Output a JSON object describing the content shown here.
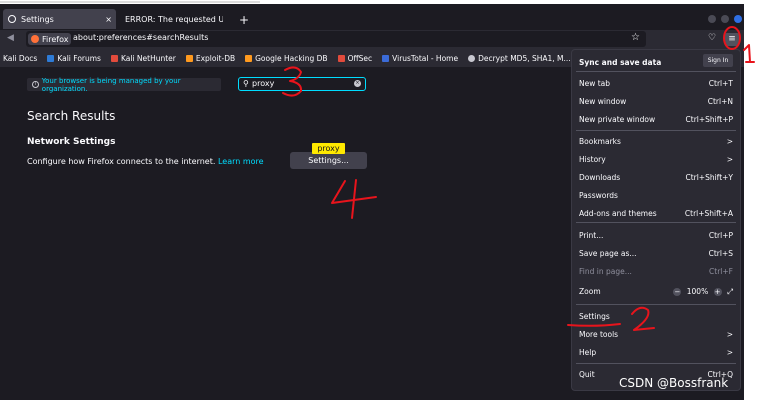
{
  "tabs": [
    {
      "label": "Settings",
      "close": "×"
    },
    {
      "label": "ERROR: The requested URL c"
    }
  ],
  "newtab_label": "+",
  "nav": {
    "identity_label": "Firefox",
    "url": "about:preferences#searchResults",
    "star_icon": "star-icon",
    "menu_icon": "≡"
  },
  "bookmarks": [
    {
      "label": "Kali Docs",
      "color": "#2e7bd6"
    },
    {
      "label": "Kali Forums",
      "color": "#2e7bd6"
    },
    {
      "label": "Kali NetHunter",
      "color": "#e24b3c"
    },
    {
      "label": "Exploit-DB",
      "color": "#ff9a1f"
    },
    {
      "label": "Google Hacking DB",
      "color": "#ff9a1f"
    },
    {
      "label": "OffSec",
      "color": "#e24b3c"
    },
    {
      "label": "VirusTotal - Home",
      "color": "#3b6bd8"
    },
    {
      "label": "Decrypt MD5, SHA1, M...",
      "color": "#c8c8d0"
    }
  ],
  "notice": "Your browser is being managed by your organization.",
  "search": {
    "value": "proxy",
    "clear": "×"
  },
  "results_title": "Search Results",
  "network": {
    "title": "Network Settings",
    "desc": "Configure how Firefox connects to the internet.",
    "learn_more": "Learn more",
    "button": "Settings...",
    "tooltip": "proxy"
  },
  "menu": {
    "sync_title": "Sync and save data",
    "signin": "Sign In",
    "items": [
      {
        "label": "New tab",
        "accel": "Ctrl+T"
      },
      {
        "label": "New window",
        "accel": "Ctrl+N"
      },
      {
        "label": "New private window",
        "accel": "Ctrl+Shift+P"
      },
      {
        "label": "Bookmarks",
        "accel": ">"
      },
      {
        "label": "History",
        "accel": ">"
      },
      {
        "label": "Downloads",
        "accel": "Ctrl+Shift+Y"
      },
      {
        "label": "Passwords",
        "accel": ""
      },
      {
        "label": "Add-ons and themes",
        "accel": "Ctrl+Shift+A"
      },
      {
        "label": "Print...",
        "accel": "Ctrl+P"
      },
      {
        "label": "Save page as...",
        "accel": "Ctrl+S"
      },
      {
        "label": "Find in page...",
        "accel": "Ctrl+F"
      },
      {
        "label": "Zoom",
        "accel": ""
      },
      {
        "label": "Settings",
        "accel": ""
      },
      {
        "label": "More tools",
        "accel": ">"
      },
      {
        "label": "Help",
        "accel": ">"
      },
      {
        "label": "Quit",
        "accel": "Ctrl+Q"
      }
    ],
    "zoom": {
      "minus": "−",
      "value": "100%",
      "plus": "+",
      "fullscreen": "⤢"
    }
  },
  "annotations": {
    "n1": "1",
    "n2": "2",
    "n3": "3",
    "n4": "4",
    "color": "#e8141c"
  },
  "watermark": "CSDN @Bossfrank"
}
